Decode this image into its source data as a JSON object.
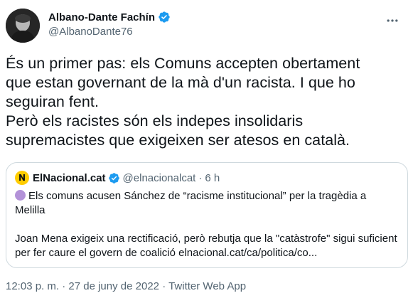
{
  "tweet": {
    "author": {
      "display_name": "Albano-Dante Fachín",
      "handle": "@AlbanoDante76",
      "verified": true
    },
    "text": "És un primer pas: els Comuns accepten obertament\nque estan governant de la mà d'un racista. I que ho\nseguiran fent.\nPerò els racistes són els indepes insolidaris\nsupremacistes que exigeixen ser atesos en català.",
    "quote": {
      "logo_letter": "N",
      "name": "ElNacional.cat",
      "verified": true,
      "handle": "@elnacionalcat",
      "separator": "·",
      "time": "6 h",
      "headline": "Els comuns acusen Sánchez de “racisme institucional” per la tragèdia a Melilla",
      "summary": "Joan Mena exigeix una rectificació, però rebutja que la \"catàstrofe\" sigui suficient per fer caure el govern de coalició elnacional.cat/ca/politica/co..."
    },
    "meta": {
      "time": "12:03 p. m.",
      "separator": "·",
      "date": "27 de juny de 2022",
      "app": "Twitter Web App"
    }
  },
  "colors": {
    "text": "#0f1419",
    "secondary": "#536471",
    "verified": "#1d9bf0",
    "border": "#cfd9de",
    "logo_bg": "#ffcc00",
    "bullet": "#b392d8"
  },
  "icons": {
    "more": "more-horizontal-icon",
    "verified": "verified-badge-icon"
  }
}
